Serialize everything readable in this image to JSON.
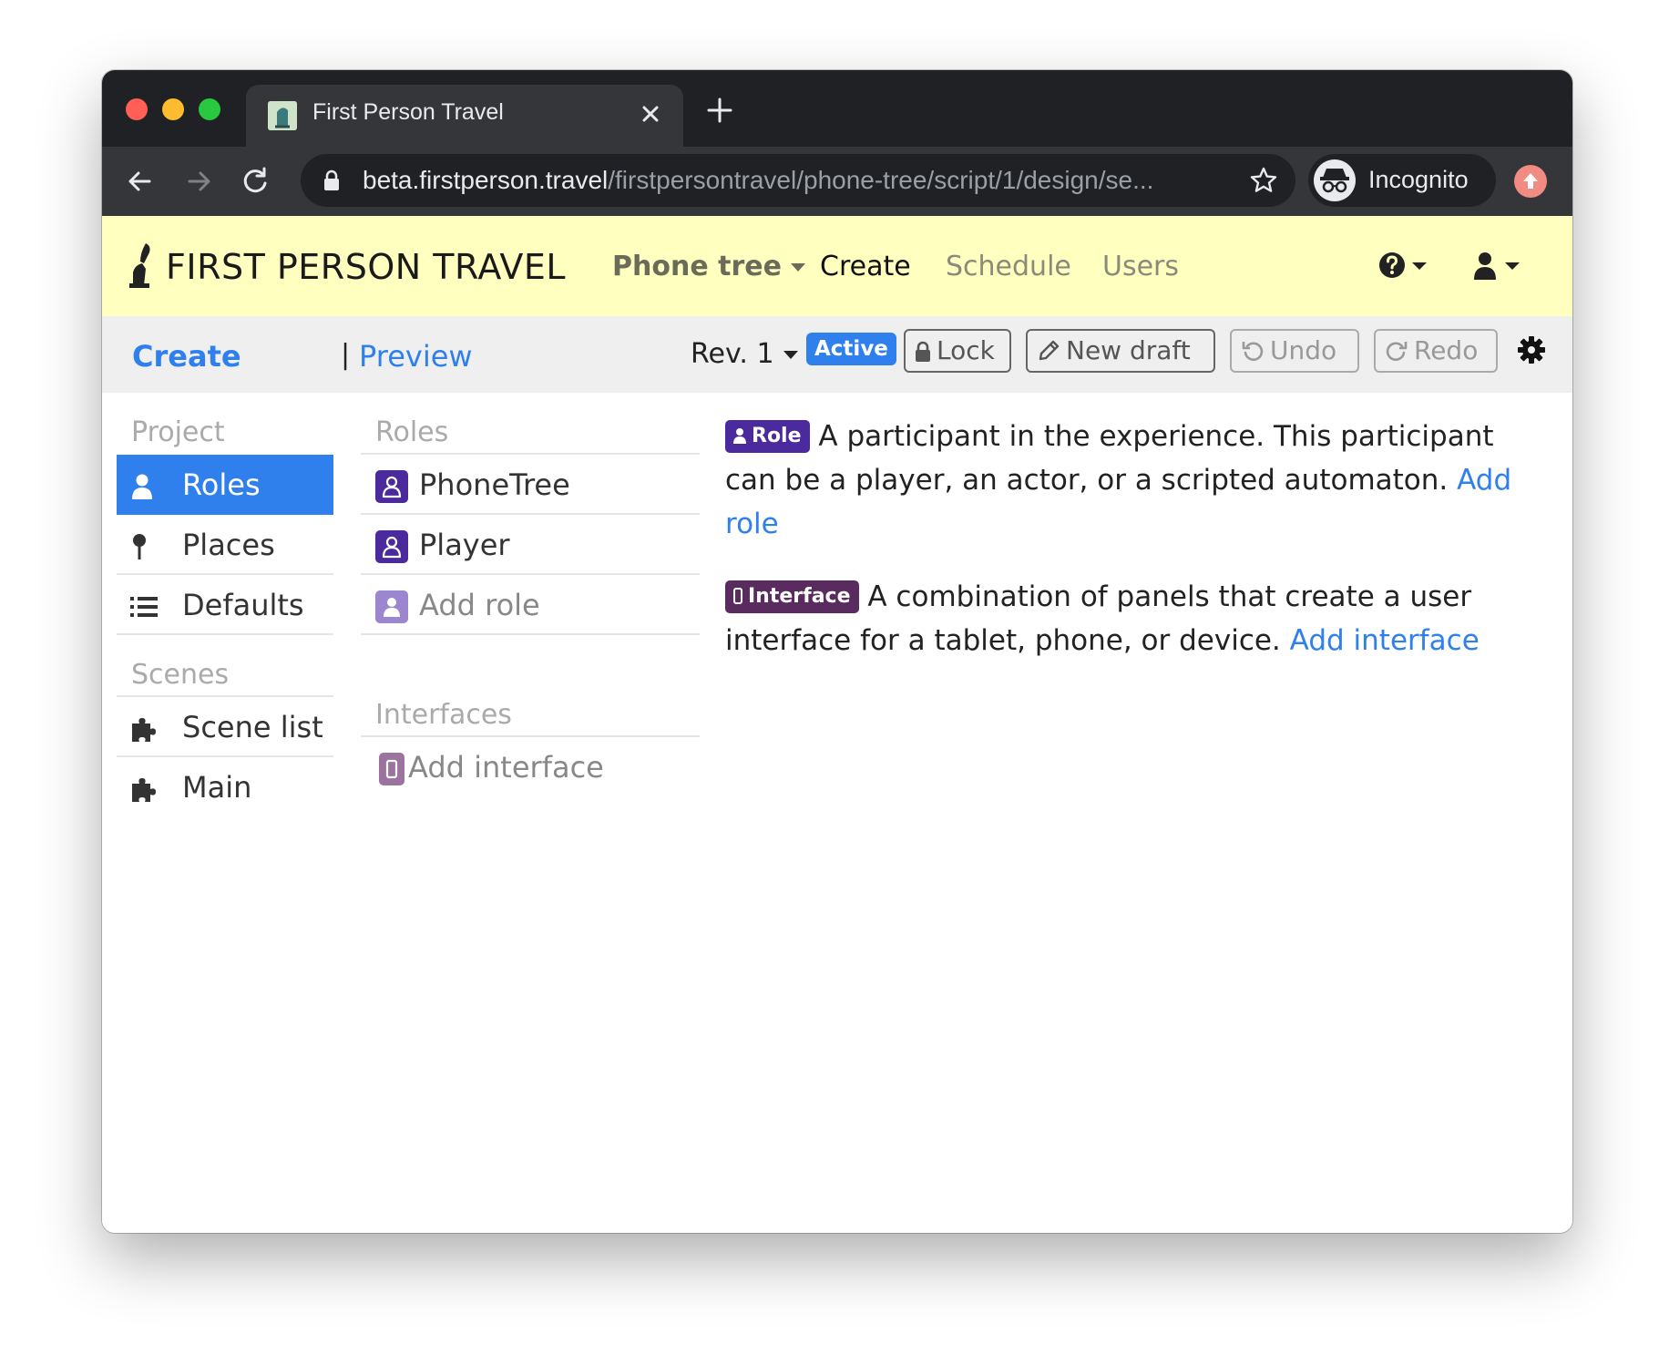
{
  "browser": {
    "tab_title": "First Person Travel",
    "url_host": "beta.firstperson.travel",
    "url_path": "/firstpersontravel/phone-tree/script/1/design/se...",
    "profile_label": "Incognito",
    "icons": [
      "back-arrow-icon",
      "forward-arrow-icon",
      "reload-icon",
      "lock-icon",
      "star-icon",
      "incognito-icon",
      "update-icon"
    ]
  },
  "navbar": {
    "brand": "FIRST PERSON TRAVEL",
    "project": "Phone tree",
    "links": [
      "Create",
      "Schedule",
      "Users"
    ]
  },
  "subbar": {
    "create": "Create",
    "separator": "|",
    "preview": "Preview",
    "revision": "Rev. 1",
    "status": "Active",
    "lock": "Lock",
    "new_draft": "New draft",
    "undo": "Undo",
    "redo": "Redo"
  },
  "sidebar": {
    "project_header": "Project",
    "project_items": [
      "Roles",
      "Places",
      "Defaults"
    ],
    "scenes_header": "Scenes",
    "scene_items": [
      "Scene list",
      "Main"
    ]
  },
  "middle": {
    "roles_header": "Roles",
    "roles": [
      "PhoneTree",
      "Player"
    ],
    "add_role": "Add role",
    "interfaces_header": "Interfaces",
    "add_interface": "Add interface"
  },
  "description": {
    "role_tag": "Role",
    "role_text": "A participant in the experience. This participant can be a player, an actor, or a scripted automaton.",
    "role_link": "Add role",
    "interface_tag": "Interface",
    "interface_text": "A combination of panels that create a user interface for a tablet, phone, or device.",
    "interface_link": "Add interface"
  },
  "colors": {
    "navbar_bg": "#ffffc0",
    "accent": "#2f80ed",
    "role_tag": "#4b2a9e",
    "interface_tag": "#5a2b5e"
  }
}
